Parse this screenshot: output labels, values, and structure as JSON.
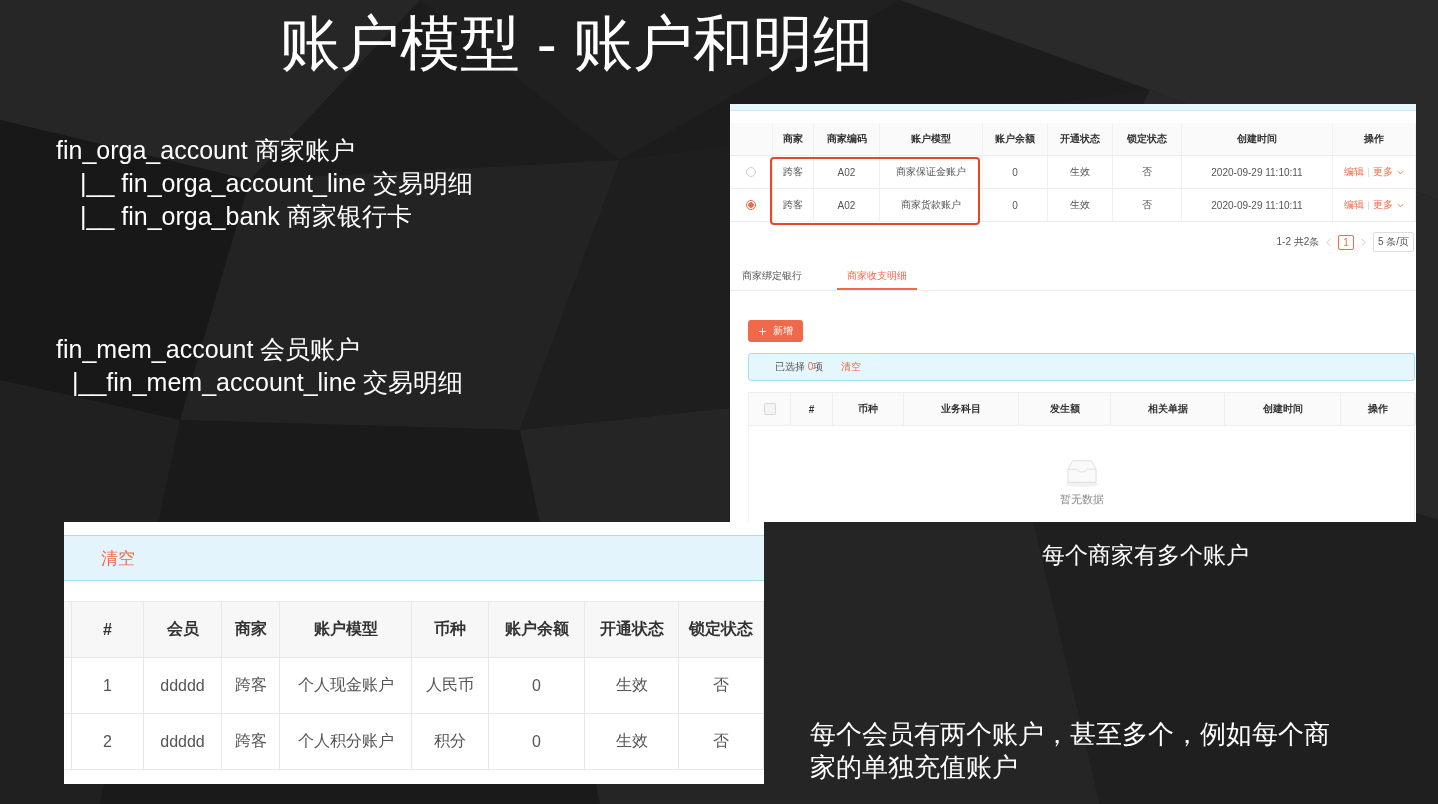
{
  "title": "账户模型 - 账户和明细",
  "outline": [
    {
      "text": "fin_orga_account  商家账户",
      "children": [
        {
          "text": "|__ fin_orga_account_line  交易明细"
        },
        {
          "text": "|__ fin_orga_bank 商家银行卡"
        }
      ]
    },
    {
      "text": "fin_mem_account  会员账户",
      "children": [
        {
          "text": "|__fin_mem_account_line 交易明细"
        }
      ]
    }
  ],
  "merchant_screenshot": {
    "columns": [
      "商家",
      "商家编码",
      "账户模型",
      "账户余额",
      "开通状态",
      "锁定状态",
      "创建时间",
      "操作"
    ],
    "rows": [
      {
        "selected": false,
        "cells": [
          "跨客",
          "A02",
          "商家保证金账户",
          "0",
          "生效",
          "否",
          "2020-09-29 11:10:11"
        ],
        "actions": [
          "编辑",
          "更多"
        ]
      },
      {
        "selected": true,
        "cells": [
          "跨客",
          "A02",
          "商家货款账户",
          "0",
          "生效",
          "否",
          "2020-09-29 11:10:11"
        ],
        "actions": [
          "编辑",
          "更多"
        ]
      }
    ],
    "highlight_frame": true,
    "pagination": {
      "summary": "1-2 共2条",
      "page": "1",
      "page_size": "5 条/页"
    },
    "tabs": [
      {
        "label": "商家绑定银行",
        "selected": false
      },
      {
        "label": "商家收支明细",
        "selected": true
      }
    ],
    "add_button": "新增",
    "selection_alert": {
      "prefix": "已选择 ",
      "count": "0",
      "suffix": "项",
      "clear": "清空"
    },
    "detail_table": {
      "checkbox_checked": false,
      "columns": [
        "#",
        "币种",
        "业务科目",
        "发生额",
        "相关单据",
        "创建时间",
        "操作"
      ],
      "empty_text": "暂无数据"
    }
  },
  "merchant_caption": "每个商家有多个账户",
  "member_screenshot": {
    "selection_alert": {
      "clear": "清空"
    },
    "columns": [
      "#",
      "会员",
      "商家",
      "账户模型",
      "币种",
      "账户余额",
      "开通状态",
      "锁定状态"
    ],
    "rows": [
      [
        "1",
        "ddddd",
        "跨客",
        "个人现金账户",
        "人民币",
        "0",
        "生效",
        "否"
      ],
      [
        "2",
        "ddddd",
        "跨客",
        "个人积分账户",
        "积分",
        "0",
        "生效",
        "否"
      ]
    ]
  },
  "member_caption": "每个会员有两个账户，甚至多个，例如每个商家的单独充值账户"
}
